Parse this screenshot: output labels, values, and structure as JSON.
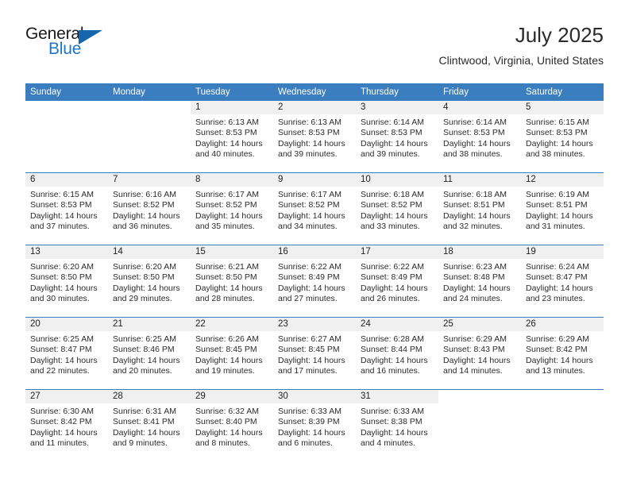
{
  "brand": {
    "name_top": "General",
    "name_bottom": "Blue",
    "accent_color": "#1f76c4",
    "triangle_color": "#1566ad"
  },
  "header": {
    "title": "July 2025",
    "location": "Clintwood, Virginia, United States"
  },
  "theme": {
    "header_bg": "#3a7ebf",
    "header_text": "#ffffff",
    "daynum_band_bg": "#f0f0f0",
    "row_divider": "#3a7ebf",
    "body_text": "#2b2b2b"
  },
  "weekday_headers": [
    "Sunday",
    "Monday",
    "Tuesday",
    "Wednesday",
    "Thursday",
    "Friday",
    "Saturday"
  ],
  "weeks": [
    [
      {
        "day": "",
        "blank": true,
        "lines": []
      },
      {
        "day": "",
        "blank": true,
        "lines": []
      },
      {
        "day": "1",
        "lines": [
          "Sunrise: 6:13 AM",
          "Sunset: 8:53 PM",
          "Daylight: 14 hours",
          "and 40 minutes."
        ]
      },
      {
        "day": "2",
        "lines": [
          "Sunrise: 6:13 AM",
          "Sunset: 8:53 PM",
          "Daylight: 14 hours",
          "and 39 minutes."
        ]
      },
      {
        "day": "3",
        "lines": [
          "Sunrise: 6:14 AM",
          "Sunset: 8:53 PM",
          "Daylight: 14 hours",
          "and 39 minutes."
        ]
      },
      {
        "day": "4",
        "lines": [
          "Sunrise: 6:14 AM",
          "Sunset: 8:53 PM",
          "Daylight: 14 hours",
          "and 38 minutes."
        ]
      },
      {
        "day": "5",
        "lines": [
          "Sunrise: 6:15 AM",
          "Sunset: 8:53 PM",
          "Daylight: 14 hours",
          "and 38 minutes."
        ]
      }
    ],
    [
      {
        "day": "6",
        "lines": [
          "Sunrise: 6:15 AM",
          "Sunset: 8:53 PM",
          "Daylight: 14 hours",
          "and 37 minutes."
        ]
      },
      {
        "day": "7",
        "lines": [
          "Sunrise: 6:16 AM",
          "Sunset: 8:52 PM",
          "Daylight: 14 hours",
          "and 36 minutes."
        ]
      },
      {
        "day": "8",
        "lines": [
          "Sunrise: 6:17 AM",
          "Sunset: 8:52 PM",
          "Daylight: 14 hours",
          "and 35 minutes."
        ]
      },
      {
        "day": "9",
        "lines": [
          "Sunrise: 6:17 AM",
          "Sunset: 8:52 PM",
          "Daylight: 14 hours",
          "and 34 minutes."
        ]
      },
      {
        "day": "10",
        "lines": [
          "Sunrise: 6:18 AM",
          "Sunset: 8:52 PM",
          "Daylight: 14 hours",
          "and 33 minutes."
        ]
      },
      {
        "day": "11",
        "lines": [
          "Sunrise: 6:18 AM",
          "Sunset: 8:51 PM",
          "Daylight: 14 hours",
          "and 32 minutes."
        ]
      },
      {
        "day": "12",
        "lines": [
          "Sunrise: 6:19 AM",
          "Sunset: 8:51 PM",
          "Daylight: 14 hours",
          "and 31 minutes."
        ]
      }
    ],
    [
      {
        "day": "13",
        "lines": [
          "Sunrise: 6:20 AM",
          "Sunset: 8:50 PM",
          "Daylight: 14 hours",
          "and 30 minutes."
        ]
      },
      {
        "day": "14",
        "lines": [
          "Sunrise: 6:20 AM",
          "Sunset: 8:50 PM",
          "Daylight: 14 hours",
          "and 29 minutes."
        ]
      },
      {
        "day": "15",
        "lines": [
          "Sunrise: 6:21 AM",
          "Sunset: 8:50 PM",
          "Daylight: 14 hours",
          "and 28 minutes."
        ]
      },
      {
        "day": "16",
        "lines": [
          "Sunrise: 6:22 AM",
          "Sunset: 8:49 PM",
          "Daylight: 14 hours",
          "and 27 minutes."
        ]
      },
      {
        "day": "17",
        "lines": [
          "Sunrise: 6:22 AM",
          "Sunset: 8:49 PM",
          "Daylight: 14 hours",
          "and 26 minutes."
        ]
      },
      {
        "day": "18",
        "lines": [
          "Sunrise: 6:23 AM",
          "Sunset: 8:48 PM",
          "Daylight: 14 hours",
          "and 24 minutes."
        ]
      },
      {
        "day": "19",
        "lines": [
          "Sunrise: 6:24 AM",
          "Sunset: 8:47 PM",
          "Daylight: 14 hours",
          "and 23 minutes."
        ]
      }
    ],
    [
      {
        "day": "20",
        "lines": [
          "Sunrise: 6:25 AM",
          "Sunset: 8:47 PM",
          "Daylight: 14 hours",
          "and 22 minutes."
        ]
      },
      {
        "day": "21",
        "lines": [
          "Sunrise: 6:25 AM",
          "Sunset: 8:46 PM",
          "Daylight: 14 hours",
          "and 20 minutes."
        ]
      },
      {
        "day": "22",
        "lines": [
          "Sunrise: 6:26 AM",
          "Sunset: 8:45 PM",
          "Daylight: 14 hours",
          "and 19 minutes."
        ]
      },
      {
        "day": "23",
        "lines": [
          "Sunrise: 6:27 AM",
          "Sunset: 8:45 PM",
          "Daylight: 14 hours",
          "and 17 minutes."
        ]
      },
      {
        "day": "24",
        "lines": [
          "Sunrise: 6:28 AM",
          "Sunset: 8:44 PM",
          "Daylight: 14 hours",
          "and 16 minutes."
        ]
      },
      {
        "day": "25",
        "lines": [
          "Sunrise: 6:29 AM",
          "Sunset: 8:43 PM",
          "Daylight: 14 hours",
          "and 14 minutes."
        ]
      },
      {
        "day": "26",
        "lines": [
          "Sunrise: 6:29 AM",
          "Sunset: 8:42 PM",
          "Daylight: 14 hours",
          "and 13 minutes."
        ]
      }
    ],
    [
      {
        "day": "27",
        "lines": [
          "Sunrise: 6:30 AM",
          "Sunset: 8:42 PM",
          "Daylight: 14 hours",
          "and 11 minutes."
        ]
      },
      {
        "day": "28",
        "lines": [
          "Sunrise: 6:31 AM",
          "Sunset: 8:41 PM",
          "Daylight: 14 hours",
          "and 9 minutes."
        ]
      },
      {
        "day": "29",
        "lines": [
          "Sunrise: 6:32 AM",
          "Sunset: 8:40 PM",
          "Daylight: 14 hours",
          "and 8 minutes."
        ]
      },
      {
        "day": "30",
        "lines": [
          "Sunrise: 6:33 AM",
          "Sunset: 8:39 PM",
          "Daylight: 14 hours",
          "and 6 minutes."
        ]
      },
      {
        "day": "31",
        "lines": [
          "Sunrise: 6:33 AM",
          "Sunset: 8:38 PM",
          "Daylight: 14 hours",
          "and 4 minutes."
        ]
      },
      {
        "day": "",
        "blank": true,
        "lines": []
      },
      {
        "day": "",
        "blank": true,
        "lines": []
      }
    ]
  ]
}
